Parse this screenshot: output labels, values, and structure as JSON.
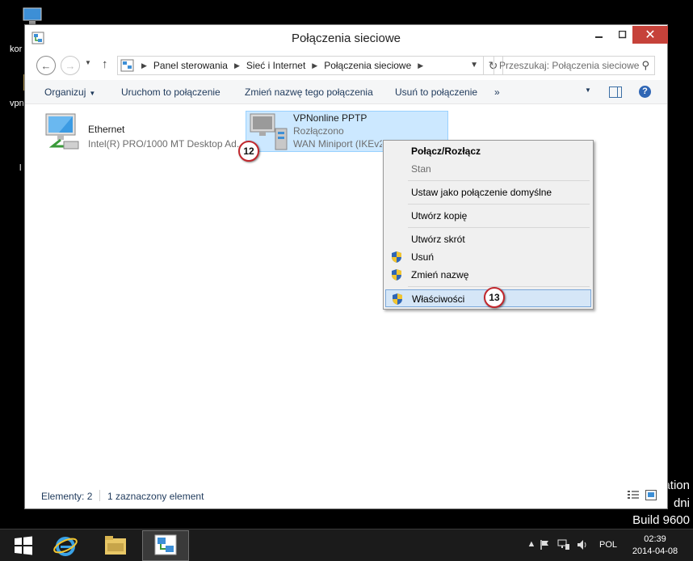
{
  "desktop": {
    "icon_labels": [
      "kor",
      "vpn",
      "l"
    ],
    "watermark": [
      "ation",
      "dni",
      "Build 9600"
    ]
  },
  "window": {
    "title": "Połączenia sieciowe",
    "close_glyph": "✕"
  },
  "address": {
    "crumbs": [
      "Panel sterowania",
      "Sieć i Internet",
      "Połączenia sieciowe"
    ],
    "search_placeholder": "Przeszukaj: Połączenia sieciowe"
  },
  "commands": {
    "organize": "Organizuj",
    "start": "Uruchom to połączenie",
    "rename": "Zmień nazwę tego połączenia",
    "delete": "Usuń to połączenie",
    "more": "»"
  },
  "items": [
    {
      "name": "Ethernet",
      "status": "",
      "device": "Intel(R) PRO/1000 MT Desktop Ad..."
    },
    {
      "name": "VPNonline PPTP",
      "status": "Rozłączono",
      "device": "WAN Miniport (IKEv2)"
    }
  ],
  "badges": [
    "12",
    "13"
  ],
  "context_menu": {
    "items": [
      {
        "label": "Połącz/Rozłącz",
        "bold": true
      },
      {
        "label": "Stan",
        "disabled": true
      },
      {
        "label": "Ustaw jako połączenie domyślne"
      },
      {
        "label": "Utwórz kopię"
      },
      {
        "label": "Utwórz skrót"
      },
      {
        "label": "Usuń",
        "shield": true
      },
      {
        "label": "Zmień nazwę",
        "shield": true
      },
      {
        "label": "Właściwości",
        "shield": true,
        "highlighted": true
      }
    ]
  },
  "status": {
    "count": "Elementy: 2",
    "selected": "1 zaznaczony element"
  },
  "taskbar": {
    "language": "POL",
    "time": "02:39",
    "date": "2014-04-08"
  },
  "colors": {
    "close_button": "#c6423a",
    "selection": "#cce8ff",
    "menu_highlight": "#d5e6f7",
    "badge_border": "#c1272d"
  }
}
